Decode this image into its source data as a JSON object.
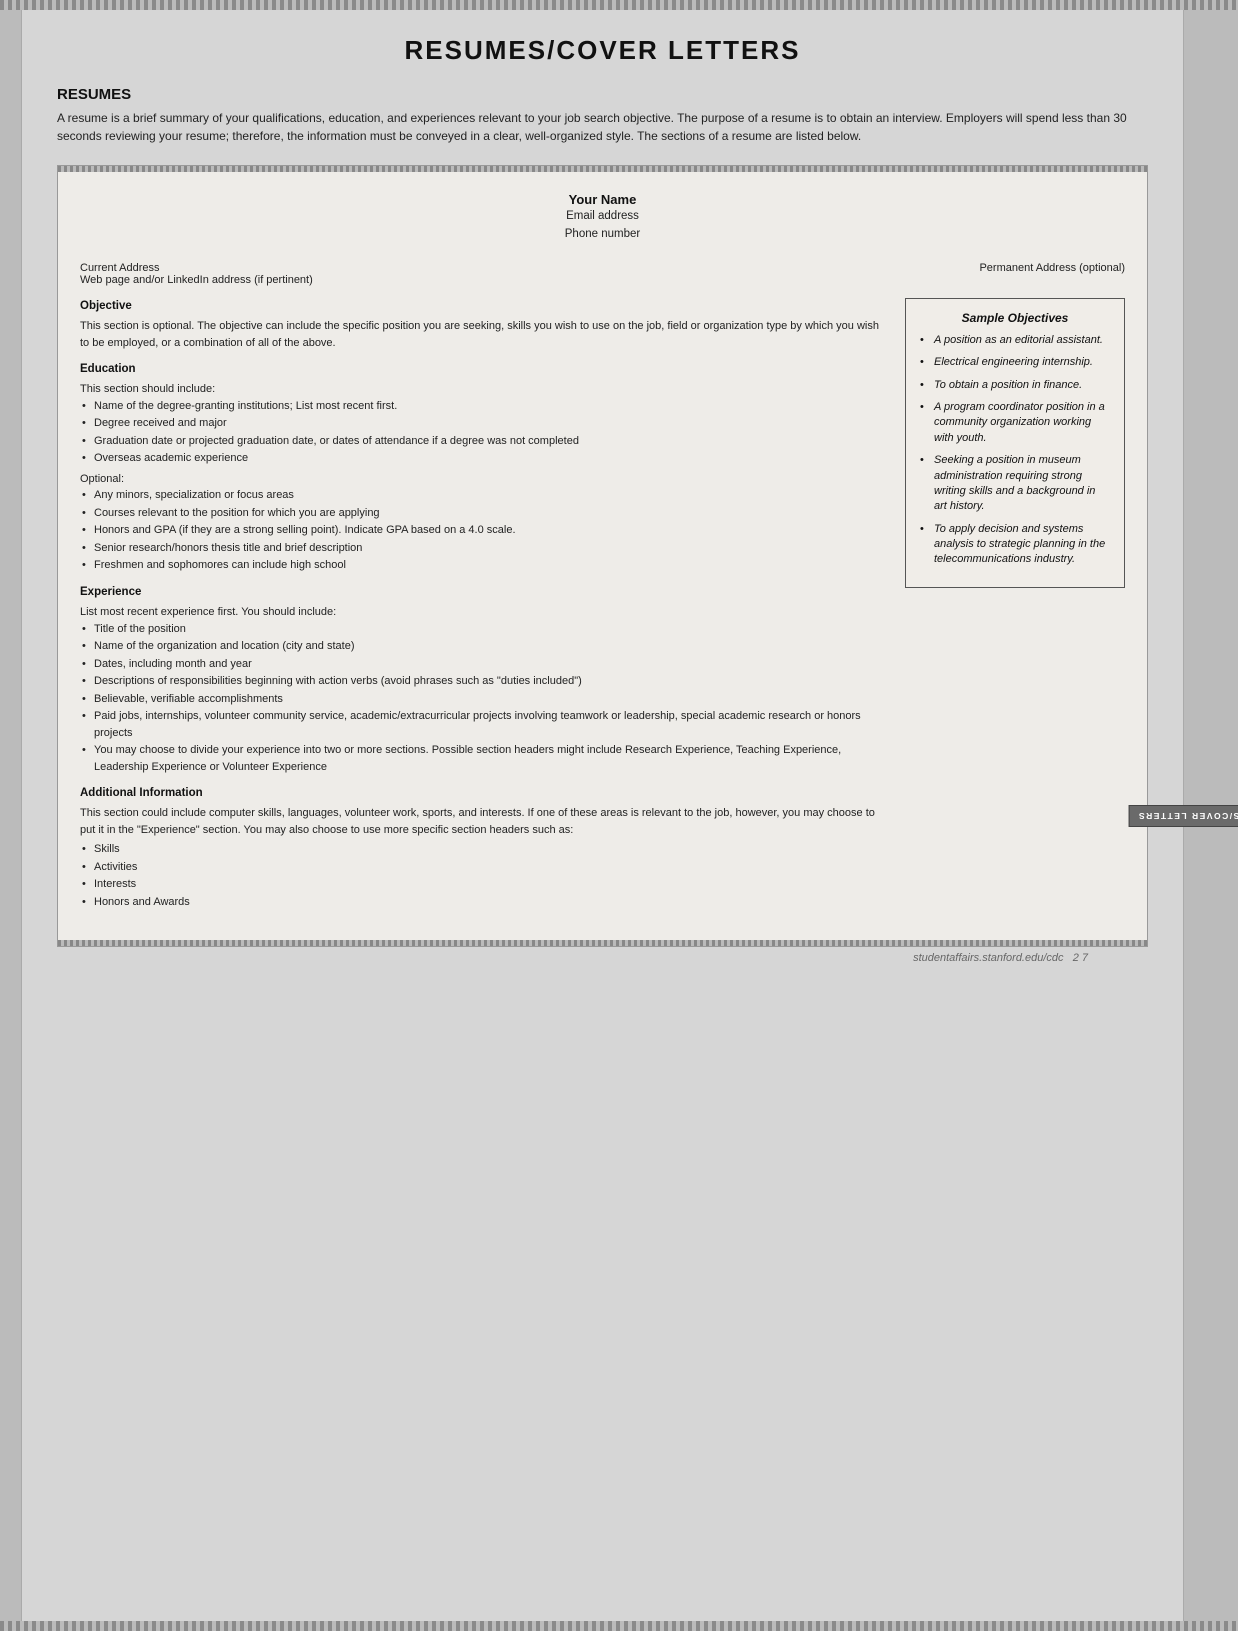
{
  "page": {
    "title": "RESUMES/COVER LETTERS",
    "footer": {
      "url": "studentaffairs.stanford.edu/cdc",
      "page": "2 7"
    }
  },
  "resumes_section": {
    "heading": "RESUMES",
    "intro": "A resume is a brief summary of your qualifications, education, and experiences relevant to your job search objective. The purpose of a resume is to obtain an interview. Employers will spend less than 30 seconds reviewing your resume; therefore, the information must be conveyed in a clear, well-organized style. The sections of a resume are listed below."
  },
  "resume_template": {
    "name": "Your Name",
    "email": "Email address",
    "phone": "Phone number",
    "address_left_line1": "Current Address",
    "address_left_line2": "Web page and/or LinkedIn address (if pertinent)",
    "address_right": "Permanent Address (optional)",
    "objective_title": "Objective",
    "objective_text": "This section is optional. The objective can include the specific position you are seeking, skills you wish to use on the job, field or organization type by which you wish to be employed, or a combination of all of the above.",
    "education_title": "Education",
    "education_intro": "This section should include:",
    "education_bullets": [
      "Name of the degree-granting institutions; List most recent first.",
      "Degree received and major",
      "Graduation date or projected graduation date, or dates of attendance if a degree was not completed",
      "Overseas academic experience"
    ],
    "education_optional_label": "Optional:",
    "education_optional_bullets": [
      "Any minors, specialization or focus areas",
      "Courses relevant to the position for which you are applying",
      "Honors and GPA (if they are a strong selling point). Indicate GPA based on a 4.0 scale.",
      "Senior research/honors thesis title and brief description",
      "Freshmen and sophomores can include high school"
    ],
    "experience_title": "Experience",
    "experience_intro": "List most recent experience first. You should include:",
    "experience_bullets": [
      "Title of the position",
      "Name of the organization and location (city and state)",
      "Dates, including month and year",
      "Descriptions of responsibilities beginning with action verbs (avoid phrases such as \"duties included\")",
      "Believable, verifiable accomplishments",
      "Paid jobs, internships, volunteer community service, academic/extracurricular projects involving teamwork or leadership, special academic research or honors projects",
      "You may choose to divide your experience into two or more sections. Possible section headers might include Research Experience, Teaching Experience, Leadership Experience or Volunteer Experience"
    ],
    "additional_title": "Additional Information",
    "additional_text": "This section could include computer skills, languages, volunteer work, sports, and interests. If one of these areas is relevant to the job, however, you may choose to put it in the \"Experience\" section. You may also choose to use more specific section headers such as:",
    "additional_bullets": [
      "Skills",
      "Activities",
      "Interests",
      "Honors and Awards"
    ]
  },
  "sample_objectives": {
    "title": "Sample Objectives",
    "items": [
      "A position as an editorial assistant.",
      "Electrical engineering internship.",
      "To obtain a position in finance.",
      "A program coordinator position in a community organization working with youth.",
      "Seeking a position in museum administration requiring strong writing skills and a background in art history.",
      "To apply decision and systems analysis to strategic planning in the telecommunications industry."
    ]
  },
  "sidebar_tab": {
    "label": "RESUMES/COVER LETTERS"
  }
}
